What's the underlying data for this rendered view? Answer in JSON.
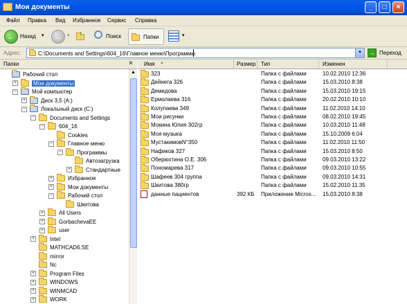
{
  "window": {
    "title": "Мои документы"
  },
  "menu": [
    "Файл",
    "Правка",
    "Вид",
    "Избранное",
    "Сервис",
    "Справка"
  ],
  "toolbar": {
    "back": "Назад",
    "search": "Поиск",
    "folders": "Папки"
  },
  "address": {
    "label": "Адрес:",
    "value": "C:\\Documents and Settings\\604_16\\Главное меню\\Программы",
    "go": "Переход"
  },
  "tree": {
    "header": "Папки",
    "items": [
      {
        "label": "Рабочий стол",
        "indent": 0,
        "exp": "",
        "icon": "desktop"
      },
      {
        "label": "Мои документы",
        "indent": 1,
        "exp": "+",
        "icon": "mydocs",
        "selected": true
      },
      {
        "label": "Мой компьютер",
        "indent": 1,
        "exp": "-",
        "icon": "computer"
      },
      {
        "label": "Диск 3,5 (A:)",
        "indent": 2,
        "exp": "+",
        "icon": "floppy"
      },
      {
        "label": "Локальный диск (C:)",
        "indent": 2,
        "exp": "-",
        "icon": "drive"
      },
      {
        "label": "Documents and Settings",
        "indent": 3,
        "exp": "-",
        "icon": "folder"
      },
      {
        "label": "604_16",
        "indent": 4,
        "exp": "-",
        "icon": "folder"
      },
      {
        "label": "Cookies",
        "indent": 5,
        "exp": "",
        "icon": "folder"
      },
      {
        "label": "Главное меню",
        "indent": 5,
        "exp": "-",
        "icon": "folder"
      },
      {
        "label": "Программы",
        "indent": 6,
        "exp": "-",
        "icon": "programs"
      },
      {
        "label": "Автозагрузка",
        "indent": 7,
        "exp": "",
        "icon": "programs"
      },
      {
        "label": "Стандартные",
        "indent": 7,
        "exp": "+",
        "icon": "programs"
      },
      {
        "label": "Избранное",
        "indent": 5,
        "exp": "+",
        "icon": "favorites"
      },
      {
        "label": "Мои документы",
        "indent": 5,
        "exp": "+",
        "icon": "folder"
      },
      {
        "label": "Рабочий стол",
        "indent": 5,
        "exp": "-",
        "icon": "folder"
      },
      {
        "label": "Шкитова",
        "indent": 6,
        "exp": "",
        "icon": "folder"
      },
      {
        "label": "All Users",
        "indent": 4,
        "exp": "+",
        "icon": "folder"
      },
      {
        "label": "GorbachevaEE",
        "indent": 4,
        "exp": "+",
        "icon": "folder"
      },
      {
        "label": "user",
        "indent": 4,
        "exp": "+",
        "icon": "folder"
      },
      {
        "label": "Intel",
        "indent": 3,
        "exp": "+",
        "icon": "folder"
      },
      {
        "label": "MATHCAD6.SE",
        "indent": 3,
        "exp": "",
        "icon": "folder"
      },
      {
        "label": "mirror",
        "indent": 3,
        "exp": "",
        "icon": "folder"
      },
      {
        "label": "Nc",
        "indent": 3,
        "exp": "",
        "icon": "folder"
      },
      {
        "label": "Program Files",
        "indent": 3,
        "exp": "+",
        "icon": "folder"
      },
      {
        "label": "WINDOWS",
        "indent": 3,
        "exp": "+",
        "icon": "folder"
      },
      {
        "label": "WINMCAD",
        "indent": 3,
        "exp": "+",
        "icon": "folder"
      },
      {
        "label": "WORK",
        "indent": 3,
        "exp": "+",
        "icon": "folder"
      }
    ]
  },
  "list": {
    "columns": [
      "Имя",
      "Размер",
      "Тип",
      "Изменен"
    ],
    "rows": [
      {
        "name": "323",
        "size": "",
        "type": "Папка с файлами",
        "date": "10.02.2010 12:36",
        "icon": "folder"
      },
      {
        "name": "Дейнега 326",
        "size": "",
        "type": "Папка с файлами",
        "date": "15.03.2010 8:38",
        "icon": "folder"
      },
      {
        "name": "Демидова",
        "size": "",
        "type": "Папка с файлами",
        "date": "15.03.2010 19:15",
        "icon": "folder"
      },
      {
        "name": "Ермолаева 316",
        "size": "",
        "type": "Папка с файлами",
        "date": "20.02.2010 10:10",
        "icon": "folder"
      },
      {
        "name": "Колупаева 349",
        "size": "",
        "type": "Папка с файлами",
        "date": "11.02.2010 14:10",
        "icon": "folder"
      },
      {
        "name": "Мои рисунки",
        "size": "",
        "type": "Папка с файлами",
        "date": "08.02.2010 19:45",
        "icon": "folder"
      },
      {
        "name": "Мокина Юлия 302гр",
        "size": "",
        "type": "Папка с файлами",
        "date": "10.03.2010 11:48",
        "icon": "folder"
      },
      {
        "name": "Моя музыка",
        "size": "",
        "type": "Папка с файлами",
        "date": "15.10.2009 6:04",
        "icon": "folder"
      },
      {
        "name": "МустакимовN°350",
        "size": "",
        "type": "Папка с файлами",
        "date": "11.02.2010 11:50",
        "icon": "folder"
      },
      {
        "name": "Нафиков 327",
        "size": "",
        "type": "Папка с файлами",
        "date": "15.03.2010 8:50",
        "icon": "folder"
      },
      {
        "name": "Оберюхтина О.Е. 306",
        "size": "",
        "type": "Папка с файлами",
        "date": "09.03.2010 13:22",
        "icon": "folder"
      },
      {
        "name": "Пономарева 317",
        "size": "",
        "type": "Папка с файлами",
        "date": "09.03.2010 10:55",
        "icon": "folder"
      },
      {
        "name": "Шафеев 304 группа",
        "size": "",
        "type": "Папка с файлами",
        "date": "09.03.2010 14:31",
        "icon": "folder"
      },
      {
        "name": "Шкитова 380гр",
        "size": "",
        "type": "Папка с файлами",
        "date": "15.02.2010 11:35",
        "icon": "folder"
      },
      {
        "name": "данные пациентов",
        "size": "392 КБ",
        "type": "Приложение Micros...",
        "date": "15.03.2010 8:38",
        "icon": "access-file"
      }
    ]
  }
}
